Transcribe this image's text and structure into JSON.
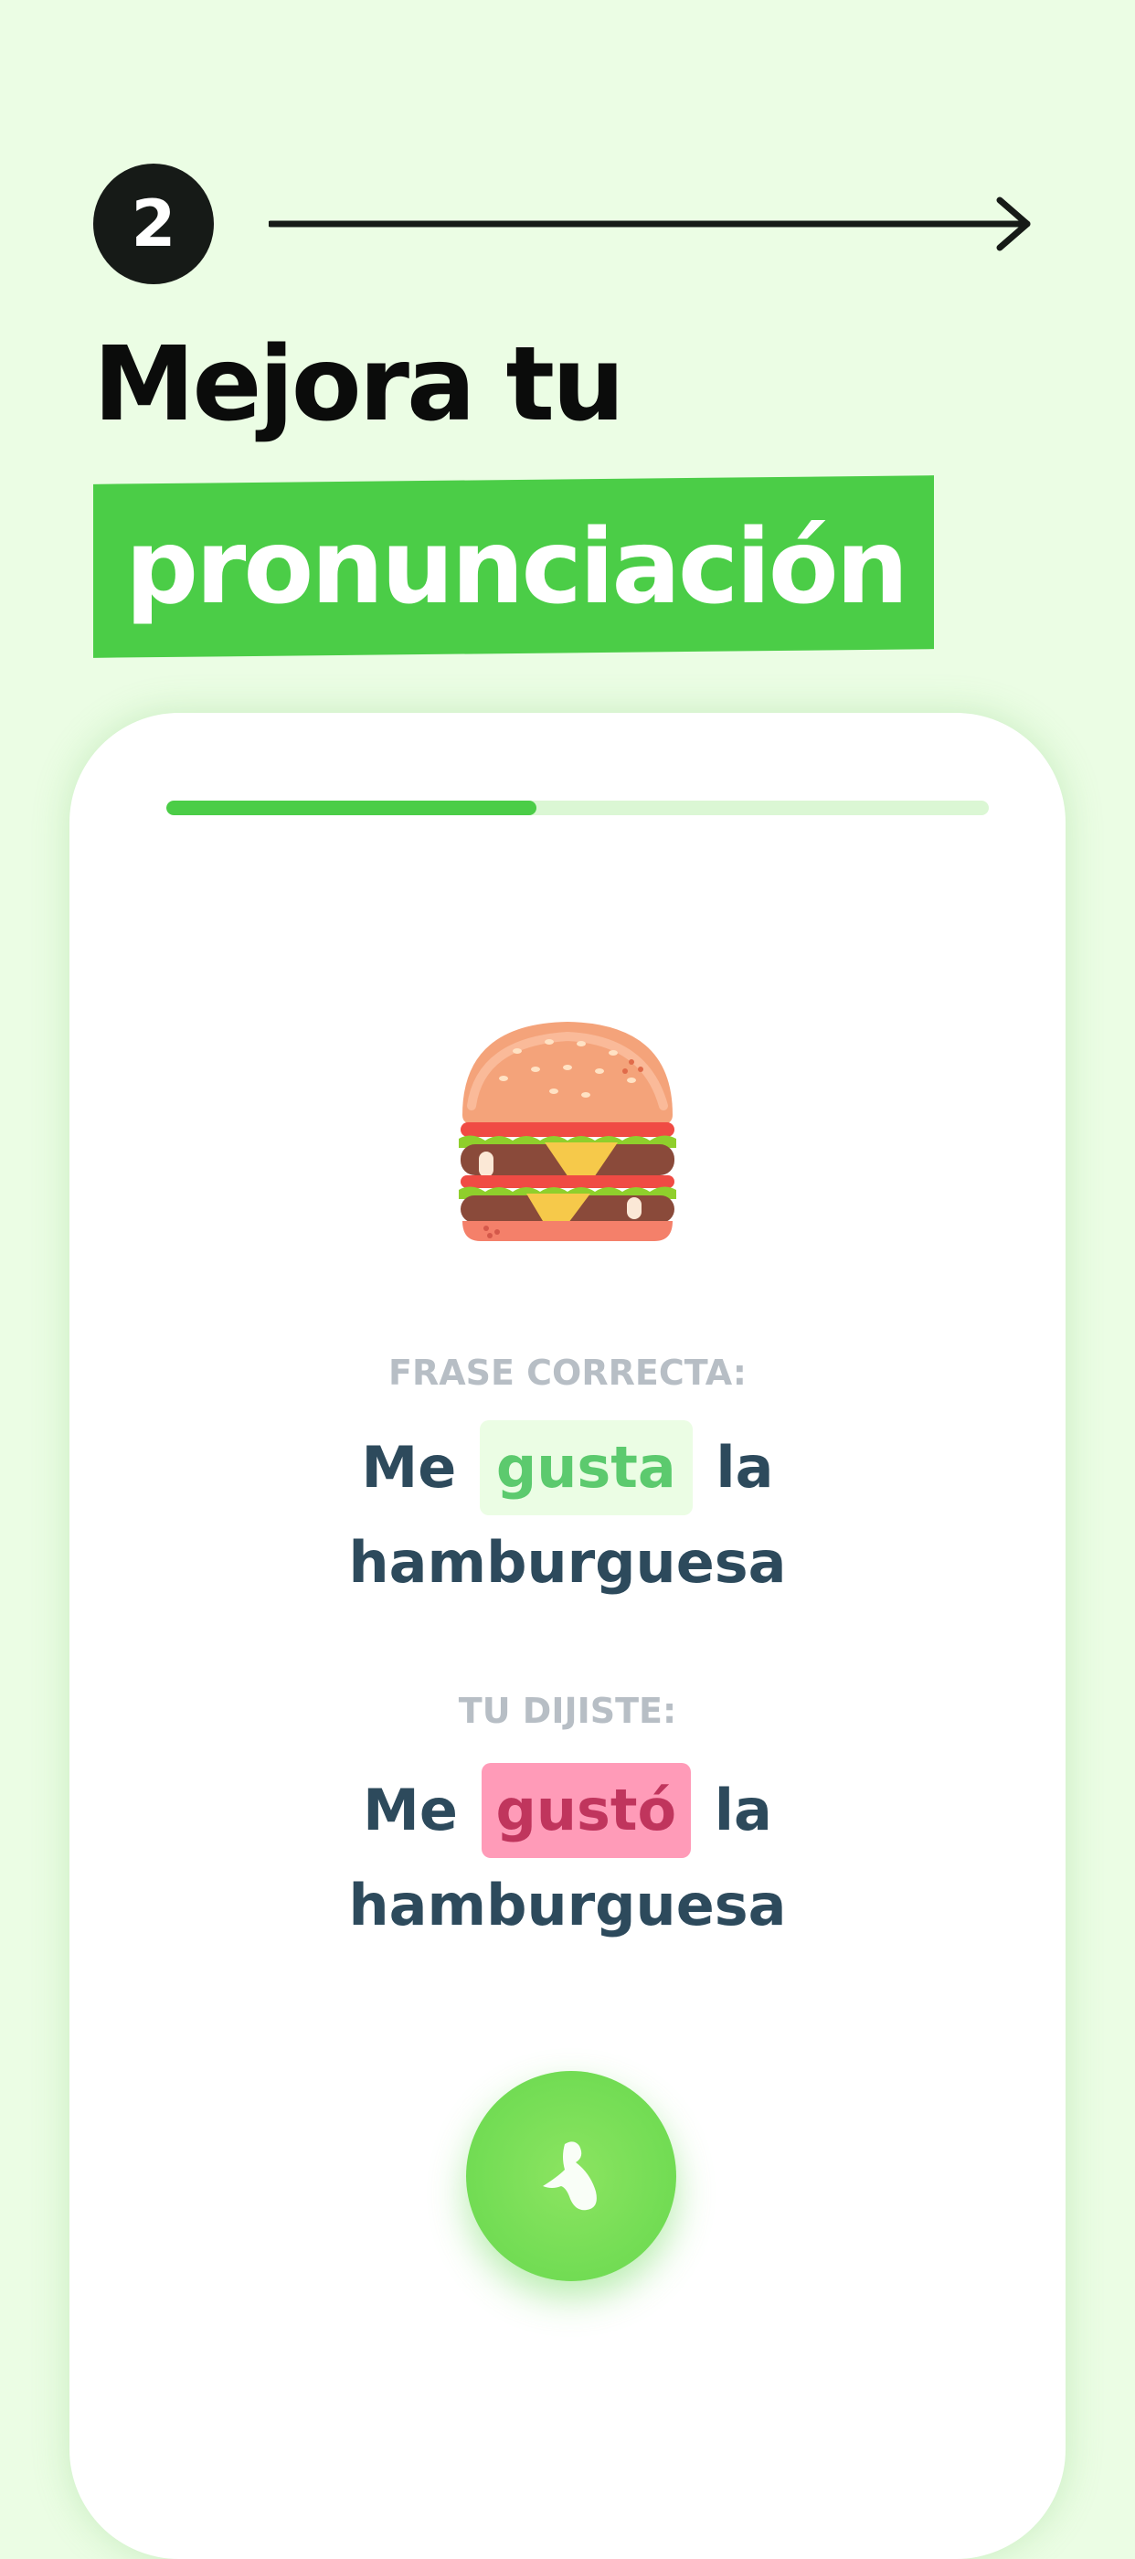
{
  "header": {
    "step_number": "2",
    "headline": "Mejora tu",
    "highlight": "pronunciación"
  },
  "lesson": {
    "progress": 0.45,
    "image_icon": "hamburger-icon",
    "correct_label": "FRASE CORRECTA:",
    "correct_sentence": {
      "before": "Me",
      "highlight": "gusta",
      "after_word": "la",
      "line2": "hamburguesa"
    },
    "said_label": "TU DIJISTE:",
    "said_sentence": {
      "before": "Me",
      "highlight": "gustó",
      "after_word": "la",
      "line2": "hamburguesa"
    },
    "mic_icon": "microphone-wave-icon"
  },
  "colors": {
    "background": "#ebfde4",
    "accent_green": "#4bcd47",
    "correct_text": "#5cca6e",
    "wrong_bg": "#ff9bb8",
    "wrong_text": "#c0355d",
    "sentence_text": "#2d4a5c",
    "label_text": "#b7bec5"
  }
}
